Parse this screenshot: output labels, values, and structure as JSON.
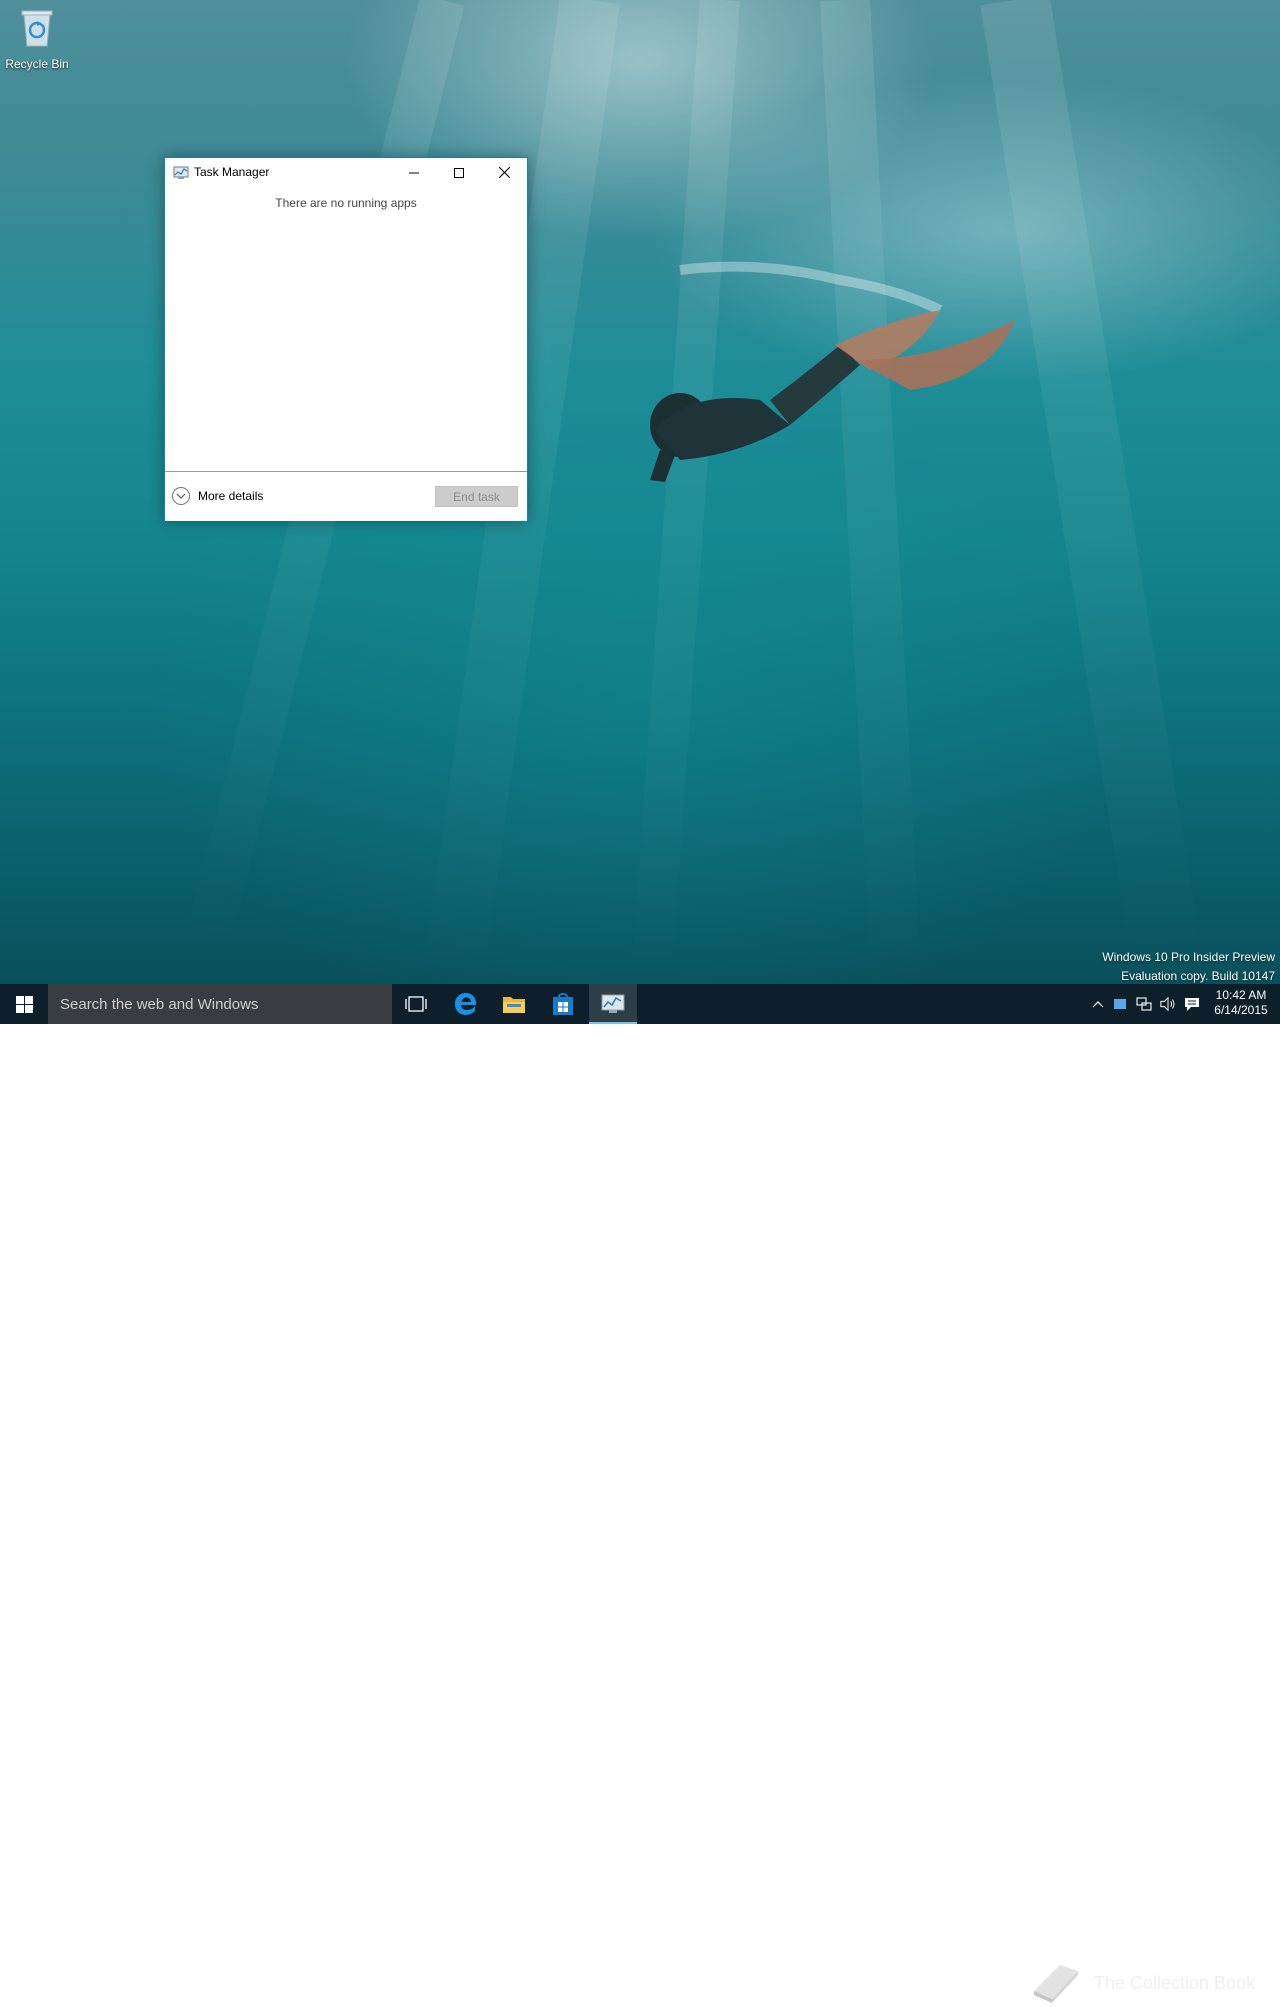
{
  "desktop": {
    "icons": [
      {
        "label": "Recycle Bin",
        "icon": "recycle-bin-icon"
      }
    ],
    "watermark": {
      "line1": "Windows 10 Pro Insider Preview",
      "line2": "Evaluation copy. Build 10147"
    }
  },
  "task_manager": {
    "title": "Task Manager",
    "message": "There are no running apps",
    "more_details_label": "More details",
    "end_task_label": "End task"
  },
  "taskbar": {
    "search_placeholder": "Search the web and Windows",
    "apps": [
      {
        "name": "Task View",
        "icon": "task-view-icon"
      },
      {
        "name": "Microsoft Edge",
        "icon": "edge-icon"
      },
      {
        "name": "File Explorer",
        "icon": "folder-icon"
      },
      {
        "name": "Store",
        "icon": "store-icon"
      },
      {
        "name": "Task Manager",
        "icon": "task-manager-icon",
        "active": true
      }
    ],
    "clock": {
      "time": "10:42 AM",
      "date": "6/14/2015"
    },
    "overlay_text": "The Collection Book"
  },
  "colors": {
    "accent": "#1979ca",
    "taskbar": "#0c1f2a",
    "search": "#393c40"
  }
}
